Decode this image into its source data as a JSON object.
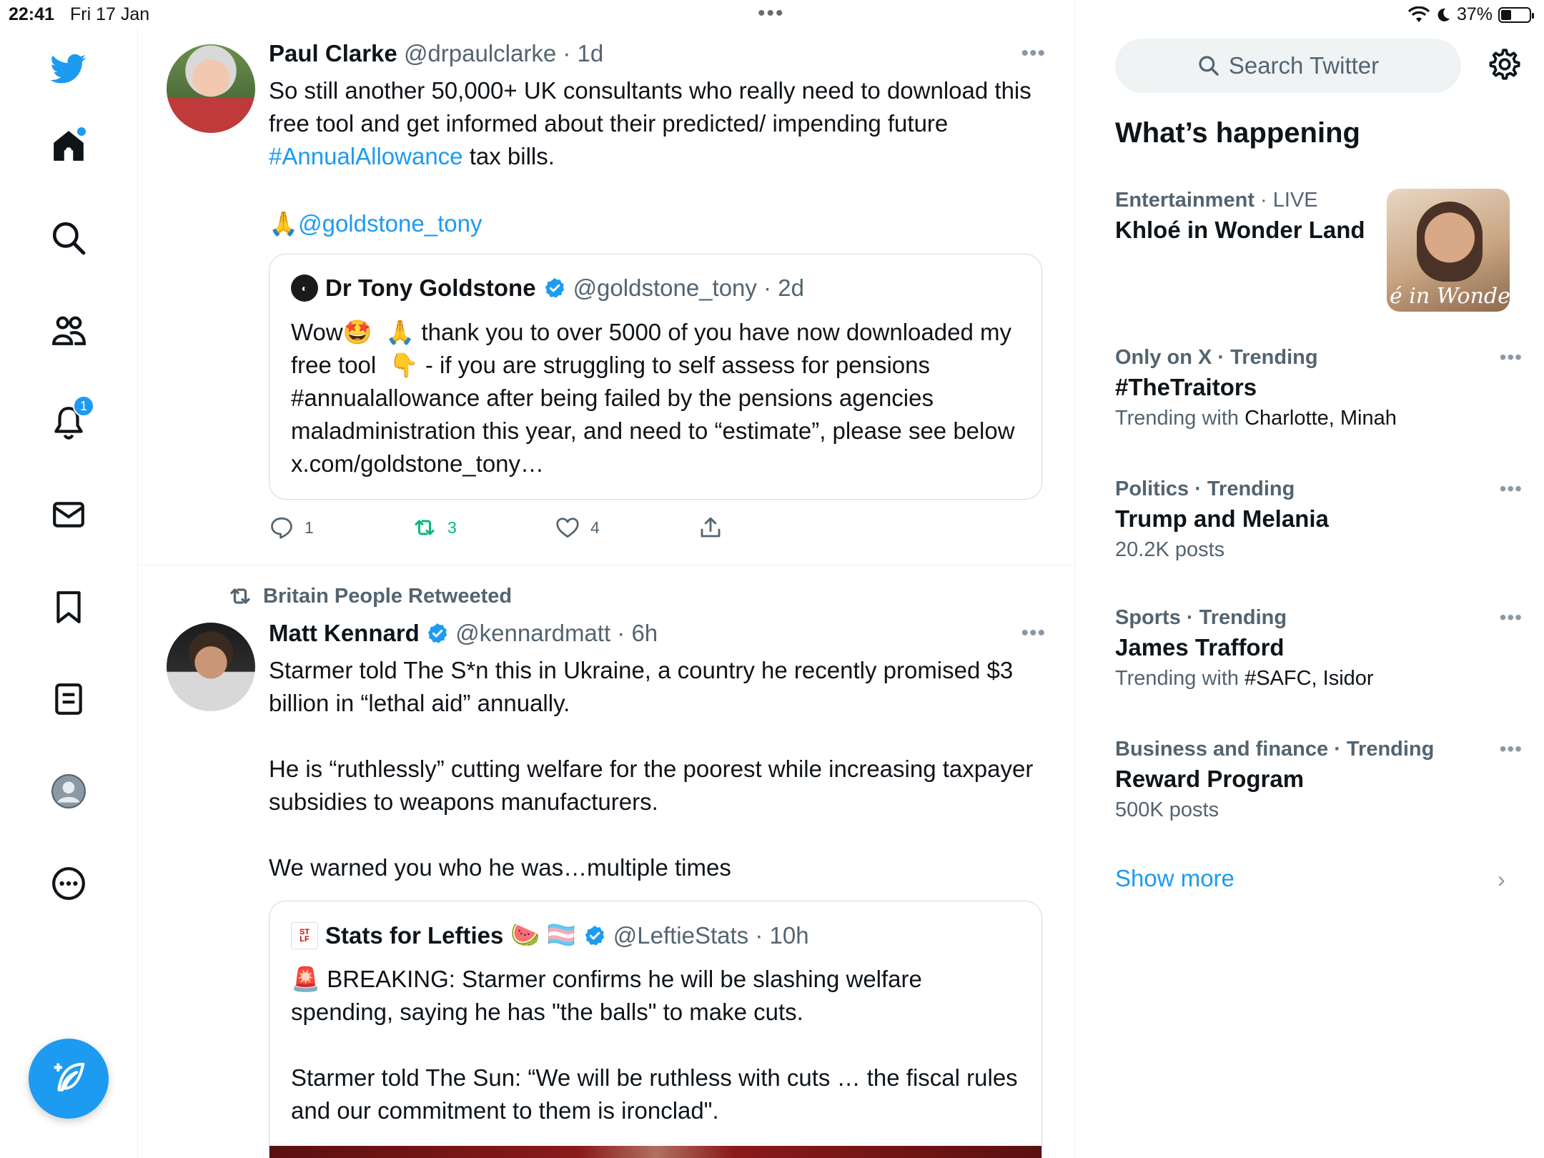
{
  "status_bar": {
    "time": "22:41",
    "date": "Fri 17 Jan",
    "dots": "•••",
    "battery": "37%",
    "battery_level": 0.37
  },
  "nav": {
    "notifications_badge": "1",
    "items": [
      "twitter-logo",
      "home",
      "explore",
      "communities",
      "notifications",
      "messages",
      "bookmarks",
      "lists",
      "profile",
      "more"
    ]
  },
  "tweets": [
    {
      "name": "Paul Clarke",
      "handle": "@drpaulclarke · 1d",
      "body_pre": "So still another 50,000+ UK consultants who really need to download this free tool and get informed about their predicted/ impending future ",
      "hashtag": "#AnnualAllowance",
      "body_post": " tax bills.",
      "emoji_link_prefix": "🙏",
      "mention": "@goldstone_tony",
      "quote": {
        "name": "Dr Tony Goldstone",
        "handle": "@goldstone_tony · 2d",
        "body": "Wow🤩  🙏 thank you to over 5000 of you have now downloaded my free tool  👇 - if you are struggling to self assess for pensions #annualallowance after being failed by the pensions agencies maladministration this year, and need to “estimate”, please see below x.com/goldstone_tony…"
      },
      "replies": "1",
      "retweets": "3",
      "likes": "4"
    },
    {
      "retweeted_by": "Britain People Retweeted",
      "name": "Matt Kennard",
      "handle": "@kennardmatt · 6h",
      "body": "Starmer told The S*n this in Ukraine, a country he recently promised $3 billion in “lethal aid” annually.\n\nHe is “ruthlessly” cutting welfare for the poorest while increasing taxpayer subsidies to weapons manufacturers.\n\nWe warned you who he was…multiple times",
      "quote": {
        "name": "Stats for Lefties",
        "name_emoji": "🍉 🏳️‍⚧️",
        "handle": "@LeftieStats · 10h",
        "body": "🚨 BREAKING: Starmer confirms he will be slashing welfare spending, saying he has \"the balls\" to make cuts.\n\nStarmer told The Sun: “We will be ruthless with cuts … the fiscal rules and our commitment to them is ironclad\"."
      }
    }
  ],
  "sidebar": {
    "search_placeholder": "Search Twitter",
    "whats_happening": "What’s happening",
    "trends": [
      {
        "category": "Entertainment",
        "context": " · LIVE",
        "name": "Khloé in Wonder Land",
        "sub_prefix": "",
        "sub_value": ""
      },
      {
        "category": "Only on X · Trending",
        "context": "",
        "name": "#TheTraitors",
        "sub_prefix": "Trending with ",
        "sub_value": "Charlotte, Minah"
      },
      {
        "category": "Politics · Trending",
        "context": "",
        "name": "Trump and Melania",
        "sub_prefix": "20.2K posts",
        "sub_value": ""
      },
      {
        "category": "Sports · Trending",
        "context": "",
        "name": "James Trafford",
        "sub_prefix": "Trending with ",
        "sub_value": "#SAFC, Isidor"
      },
      {
        "category": "Business and finance · Trending",
        "context": "",
        "name": "Reward Program",
        "sub_prefix": "500K posts",
        "sub_value": ""
      }
    ],
    "trend_image_caption": "é in Wonder l",
    "show_more": "Show more"
  },
  "colors": {
    "accent": "#1d9bf0",
    "retweet_green": "#00ba7c",
    "muted": "#536471"
  }
}
